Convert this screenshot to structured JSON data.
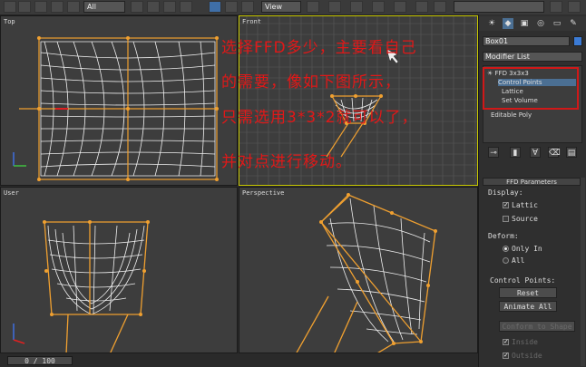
{
  "toolbar": {
    "selection_filter": "All",
    "reference_coord": "View"
  },
  "viewports": {
    "top": "Top",
    "front": "Front",
    "user": "User",
    "perspective": "Perspective"
  },
  "annotation": {
    "line1": "选择FFD多少，主要看自己",
    "line2": "的需要，像如下图所示，",
    "line3": "只需选用3*3*2就可以了，",
    "line4": "并对点进行移动。"
  },
  "command_panel": {
    "object_name": "Box01",
    "object_color": "#3b7bd6",
    "modifier_list": "Modifier List",
    "stack": [
      {
        "label": "FFD 3x3x3",
        "selected": false
      },
      {
        "label": "Control Points",
        "selected": true
      },
      {
        "label": "Lattice",
        "selected": false
      },
      {
        "label": "Set Volume",
        "selected": false
      },
      {
        "label": "Editable Poly",
        "selected": false
      }
    ],
    "rollout_title": "FFD Parameters",
    "display_label": "Display:",
    "lattice_label": "Lattic",
    "source_label": "Source",
    "deform_label": "Deform:",
    "only_in_label": "Only In",
    "all_label": "All",
    "control_points_label": "Control Points:",
    "reset_label": "Reset",
    "animate_all_label": "Animate All",
    "conform_label": "Conform to Shape",
    "inside_label": "Inside",
    "outside_label": "Outside"
  },
  "timeline": {
    "frame": "0 / 100"
  },
  "colors": {
    "annotation_red": "#e01818",
    "lattice_orange": "#f0a030",
    "viewport_bg": "#3d3d3d"
  }
}
